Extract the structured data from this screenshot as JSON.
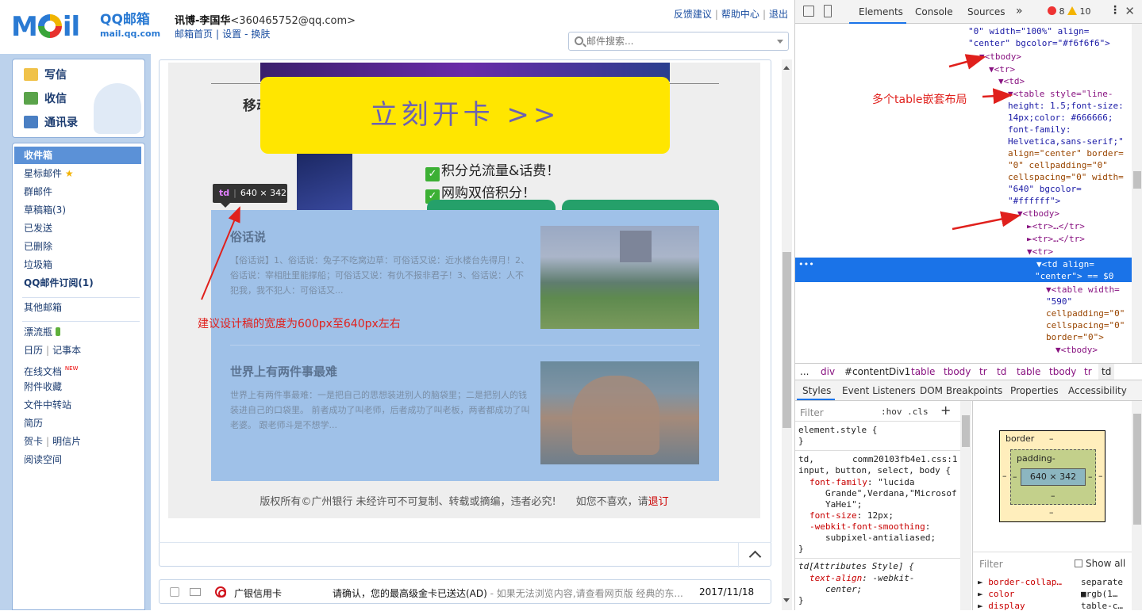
{
  "mail": {
    "logo": {
      "brand": "QQ邮箱",
      "domain": "mail.qq.com"
    },
    "account": {
      "name": "讯博-李国华",
      "email": "<360465752@qq.com>"
    },
    "account_links": [
      "邮箱首页",
      "设置",
      "换肤"
    ],
    "top_links": [
      "反馈建议",
      "帮助中心",
      "退出"
    ],
    "search": {
      "placeholder": "邮件搜索..."
    },
    "actions": [
      {
        "label": "写信",
        "icon": "write-icon"
      },
      {
        "label": "收信",
        "icon": "inbox-icon"
      },
      {
        "label": "通讯录",
        "icon": "contacts-icon"
      }
    ],
    "folders": {
      "inbox": "收件箱",
      "starred": "星标邮件",
      "group": "群邮件",
      "drafts": "草稿箱(3)",
      "sent": "已发送",
      "deleted": "已删除",
      "junk": "垃圾箱",
      "subscriptions": "QQ邮件订阅(1)",
      "other": "其他邮箱",
      "bottle": "漂流瓶",
      "calendar": "日历",
      "notes": "记事本",
      "docs": "在线文档",
      "docs_badge": "NEW",
      "attachments": "附件收藏",
      "transfer": "文件中转站",
      "resume": "简历",
      "greeting": "贺卡",
      "postcard": "明信片",
      "reading": "阅读空间"
    },
    "ad": {
      "cta": "立刻开卡 >>",
      "partial_title": "移动",
      "bullet1": "积分兑流量&话费！",
      "bullet2": "网购双倍积分！"
    },
    "tooltip": {
      "tag": "td",
      "size": "640 × 342"
    },
    "articles": [
      {
        "title": "俗话说",
        "desc": "【俗话说】1、俗话说：兔子不吃窝边草：可俗话又说：近水楼台先得月！2、俗话说：宰相肚里能撑船；可俗话又说：有仇不报非君子！3、俗话说：人不犯我，我不犯人：可俗话又..."
      },
      {
        "title": "世界上有两件事最难",
        "desc": "世界上有两件事最难：一是把自己的思想装进别人的脑袋里；二是把别人的钱装进自己的口袋里。 前者成功了叫老师，后者成功了叫老板，两者都成功了叫老婆。 跟老师斗是不想学..."
      }
    ],
    "copyright": {
      "text": "版权所有©广州银行 未经许可不可复制、转载或摘编，违者必究!",
      "unsub_prefix": "如您不喜欢，请",
      "unsub_link": "退订"
    },
    "annotation": "建议设计稿的宽度为600px至640px左右",
    "mail_row": {
      "sender": "广银信用卡",
      "subject": "请确认，您的最高级金卡已送达(AD)",
      "preview": " - 如果无法浏览内容,请查看网页版 经典的东...",
      "date": "2017/11/18"
    }
  },
  "devtools": {
    "tabs": [
      "Elements",
      "Console",
      "Sources"
    ],
    "errors": "8",
    "warnings": "10",
    "annotation": "多个table嵌套布局",
    "dom_lines": [
      {
        "t": "\"0\" width=\"100%\" align="
      },
      {
        "t": "\"center\" bgcolor=\"#f6f6f6\">"
      },
      {
        "t": "▼<tbody>"
      },
      {
        "t": "▼<tr>"
      },
      {
        "t": "▼<td>"
      },
      {
        "t": "▼<table style=\"line-"
      },
      {
        "t": "height: 1.5;font-size:"
      },
      {
        "t": "14px;color: #666666;"
      },
      {
        "t": "font-family:"
      },
      {
        "t": "Helvetica,sans-serif;\""
      },
      {
        "t": "align=\"center\" border="
      },
      {
        "t": "\"0\" cellpadding=\"0\""
      },
      {
        "t": "cellspacing=\"0\" width="
      },
      {
        "t": "\"640\" bgcolor="
      },
      {
        "t": "\"#ffffff\">"
      },
      {
        "t": "▼<tbody>"
      },
      {
        "t": "►<tr>…</tr>"
      },
      {
        "t": "►<tr>…</tr>"
      },
      {
        "t": "▼<tr>"
      },
      {
        "t": "▼<td align="
      },
      {
        "t": "\"center\"> == $0"
      },
      {
        "t": "▼<table width="
      },
      {
        "t": "\"590\""
      },
      {
        "t": "cellpadding=\"0\""
      },
      {
        "t": "cellspacing=\"0\""
      },
      {
        "t": "border=\"0\">"
      },
      {
        "t": "▼<tbody>"
      }
    ],
    "breadcrumbs": [
      "...",
      "div",
      "#contentDiv1",
      "table",
      "tbody",
      "tr",
      "td",
      "table",
      "tbody",
      "tr",
      "td"
    ],
    "style_tabs": [
      "Styles",
      "Event Listeners",
      "DOM Breakpoints",
      "Properties",
      "Accessibility"
    ],
    "filter_placeholder": "Filter",
    "hov_cls": ":hov  .cls",
    "rules": {
      "element_style": "element.style {",
      "close": "}",
      "td_selector": "td,",
      "td_src": "comm20103fb4e1.css:1",
      "td_selector2": "input, button, select, body {",
      "ff_key": "font-family",
      "ff_val": ": \"lucida",
      "ff_val2": "Grande\",Verdana,\"Microsof",
      "ff_val3": "YaHei\";",
      "fs_key": "font-size",
      "fs_val": ": 12px;",
      "wk_key": "-webkit-font-smoothing",
      "wk_val": ":",
      "wk_val2": "subpixel-antialiased;",
      "attr_selector": "td[Attributes Style] {",
      "ta_key": "text-align",
      "ta_val": ": -webkit-",
      "ta_val2": "center;"
    },
    "box_model": {
      "border": "border",
      "border_val": "–",
      "padding": "padding-",
      "content": "640 × 342",
      "dash": "–"
    },
    "computed_filter": "Filter",
    "show_all": "Show all",
    "computed": [
      {
        "k": "border-collap…",
        "v": "separate"
      },
      {
        "k": "color",
        "v": "■rgb(1…"
      },
      {
        "k": "display",
        "v": "table-c…"
      }
    ]
  }
}
